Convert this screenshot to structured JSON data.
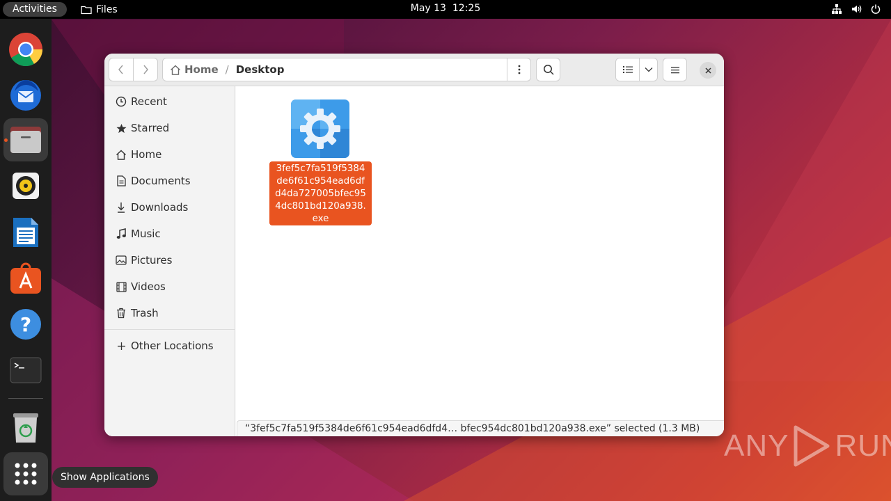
{
  "topbar": {
    "activities": "Activities",
    "app_name": "Files",
    "clock_date": "May 13",
    "clock_time": "12:25"
  },
  "dock": {
    "items": [
      {
        "name": "chrome",
        "icon": "chrome-icon"
      },
      {
        "name": "thunderbird",
        "icon": "thunderbird-icon"
      },
      {
        "name": "files",
        "icon": "files-icon",
        "active": true
      },
      {
        "name": "rhythmbox",
        "icon": "rhythmbox-icon"
      },
      {
        "name": "libreoffice-writer",
        "icon": "writer-icon"
      },
      {
        "name": "app-center",
        "icon": "app-center-icon"
      },
      {
        "name": "help",
        "icon": "help-icon"
      },
      {
        "name": "terminal",
        "icon": "terminal-icon"
      },
      {
        "name": "trash",
        "icon": "trash-icon"
      },
      {
        "name": "show-applications",
        "icon": "grid-icon"
      }
    ],
    "tooltip": "Show Applications"
  },
  "window": {
    "path": {
      "home": "Home",
      "separator": "/",
      "current": "Desktop"
    },
    "sidebar": {
      "items": [
        {
          "label": "Recent",
          "icon": "clock-icon"
        },
        {
          "label": "Starred",
          "icon": "star-icon"
        },
        {
          "label": "Home",
          "icon": "home-icon"
        },
        {
          "label": "Documents",
          "icon": "document-icon"
        },
        {
          "label": "Downloads",
          "icon": "download-icon"
        },
        {
          "label": "Music",
          "icon": "music-icon"
        },
        {
          "label": "Pictures",
          "icon": "picture-icon"
        },
        {
          "label": "Videos",
          "icon": "video-icon"
        },
        {
          "label": "Trash",
          "icon": "trash-icon"
        }
      ],
      "other_locations": "Other Locations"
    },
    "files": [
      {
        "name": "3fef5c7fa519f5384de6f61c954ead6dfd4da727005bfec954dc801bd120a938.exe",
        "icon": "executable-gear-icon",
        "selected": true
      }
    ],
    "file_label_lines": [
      "3fef5c7fa519f5384",
      "de6f61c954ead6df",
      "d4da727005bfec95",
      "4dc801bd120a938.",
      "exe"
    ],
    "status": "“3fef5c7fa519f5384de6f61c954ead6dfd4… bfec954dc801bd120a938.exe” selected (1.3 MB)"
  },
  "watermark": {
    "left": "ANY",
    "right": "RUN"
  },
  "colors": {
    "accent": "#e95420",
    "topbar": "#000000",
    "dock": "#1d1d1d"
  }
}
